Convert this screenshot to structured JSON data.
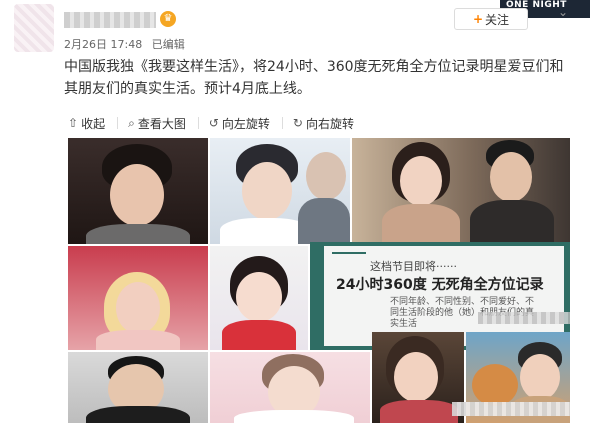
{
  "header": {
    "username": "",
    "meta": {
      "date": "2月26日 17:48",
      "edited": "已编辑"
    },
    "follow_label": "关注",
    "corner_logo_text": "ONE NIGHT"
  },
  "post": {
    "text": "中国版我独《我要这样生活》，将24小时、360度无死角全方位记录明星爱豆们和其朋友们的真实生活。预计4月底上线。"
  },
  "toolbar": {
    "items": [
      {
        "label": "收起",
        "icon": "collapse-icon"
      },
      {
        "label": "查看大图",
        "icon": "search-icon"
      },
      {
        "label": "向左旋转",
        "icon": "rotate-left-icon"
      },
      {
        "label": "向右旋转",
        "icon": "rotate-right-icon"
      }
    ]
  },
  "promo": {
    "line1": "这档节目即将······",
    "line2": "24小时360度 无死角全方位记录",
    "line3": "不同年龄、不同性别、不同爱好、不同生活阶段的他（她）和朋友们的真实生活"
  },
  "colors": {
    "follow_plus": "#ff8200",
    "promo_bg": "#2f6d64"
  }
}
